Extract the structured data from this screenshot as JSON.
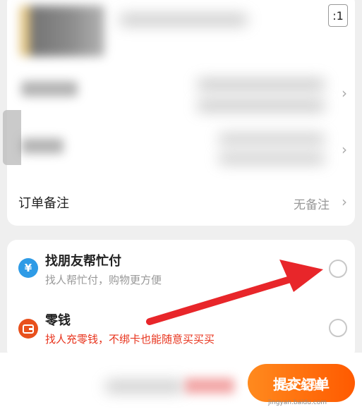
{
  "product": {
    "quantity": ":1"
  },
  "rows": {
    "order_note_label": "订单备注",
    "order_note_value": "无备注"
  },
  "payment": {
    "friend_pay_title": "找朋友帮忙付",
    "friend_pay_sub": "找人帮忙付，购物更方便",
    "change_title": "零钱",
    "change_sub": "找人充零钱，不绑卡也能随意买买买"
  },
  "footer": {
    "submit_label": "提交订单",
    "watermark": "Bai 经验",
    "watermark_url": "jingyan.baidu.com"
  },
  "colors": {
    "accent_orange": "#ff5a00",
    "promo_red": "#e8331c",
    "friend_pay_icon": "#2e9be6",
    "change_icon": "#e8501c",
    "annotation_arrow": "#e8262a"
  },
  "icons": {
    "friend_pay": "yuan-hand-icon",
    "change": "wallet-icon",
    "chevron": "chevron-right-icon"
  }
}
